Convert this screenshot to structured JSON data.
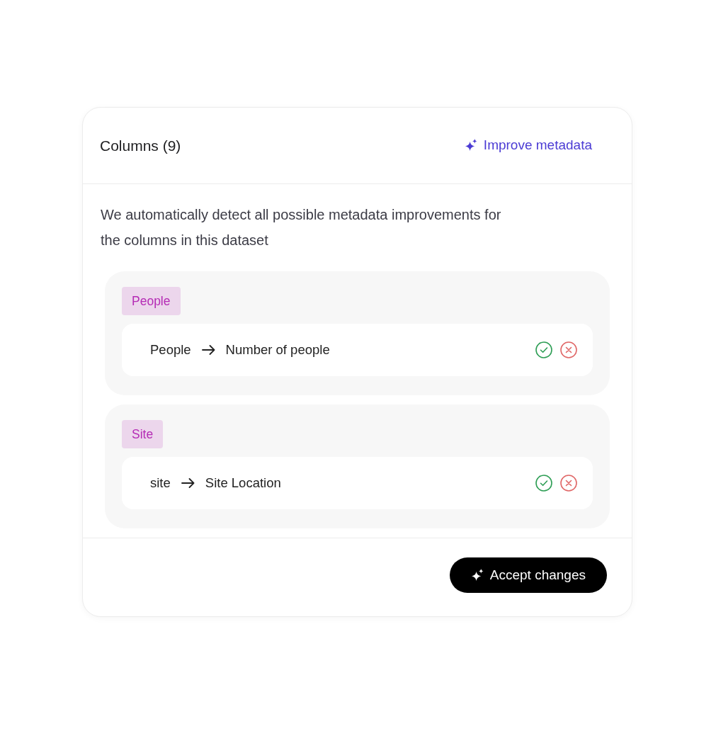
{
  "card": {
    "title": "Columns (9)",
    "action": {
      "label": "Improve metadata"
    }
  },
  "description": "We automatically detect all possible metadata improvements for the columns in this dataset",
  "groups": [
    {
      "tag": "People",
      "changes": [
        {
          "from": "People",
          "to": "Number of people"
        }
      ]
    },
    {
      "tag": "Site",
      "changes": [
        {
          "from": "site",
          "to": "Site Location"
        }
      ]
    }
  ],
  "footer": {
    "button": "Accept changes"
  }
}
